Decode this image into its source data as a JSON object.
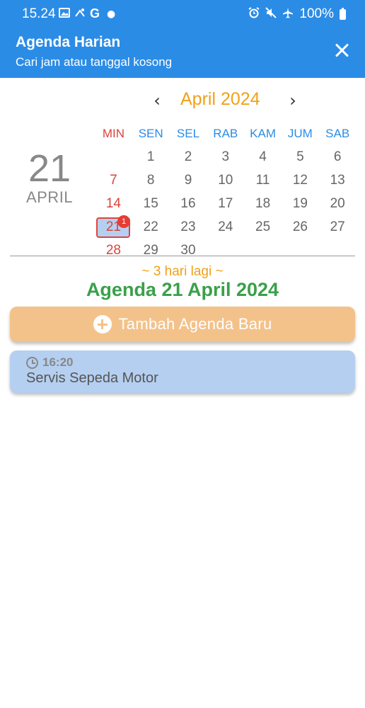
{
  "status_bar": {
    "time": "15.24",
    "left_icons": [
      "image-icon",
      "cast-icon",
      "g-icon",
      "dot-icon"
    ],
    "right_icons": [
      "alarm-icon",
      "mute-icon",
      "airplane-icon"
    ],
    "battery": "100%"
  },
  "app_bar": {
    "title": "Agenda Harian",
    "subtitle": "Cari jam atau tanggal kosong",
    "close_icon": "close-icon"
  },
  "calendar": {
    "month_label": "April 2024",
    "selected_day": "21",
    "selected_month": "APRIL",
    "weekdays": [
      "MIN",
      "SEN",
      "SEL",
      "RAB",
      "KAM",
      "JUM",
      "SAB"
    ],
    "weeks": [
      [
        "",
        "1",
        "2",
        "3",
        "4",
        "5",
        "6"
      ],
      [
        "7",
        "8",
        "9",
        "10",
        "11",
        "12",
        "13"
      ],
      [
        "14",
        "15",
        "16",
        "17",
        "18",
        "19",
        "20"
      ],
      [
        "21",
        "22",
        "23",
        "24",
        "25",
        "26",
        "27"
      ],
      [
        "28",
        "29",
        "30",
        "",
        "",
        "",
        ""
      ]
    ],
    "selected_badge": "1",
    "colors": {
      "accent": "#2b8ce6",
      "sunday": "#d9443a",
      "month": "#f0a11a"
    }
  },
  "agenda": {
    "days_left": "~ 3 hari lagi ~",
    "heading": "Agenda 21 April 2024",
    "add_button": "Tambah Agenda Baru",
    "events": [
      {
        "time": "16:20",
        "title": "Servis Sepeda Motor"
      }
    ]
  }
}
